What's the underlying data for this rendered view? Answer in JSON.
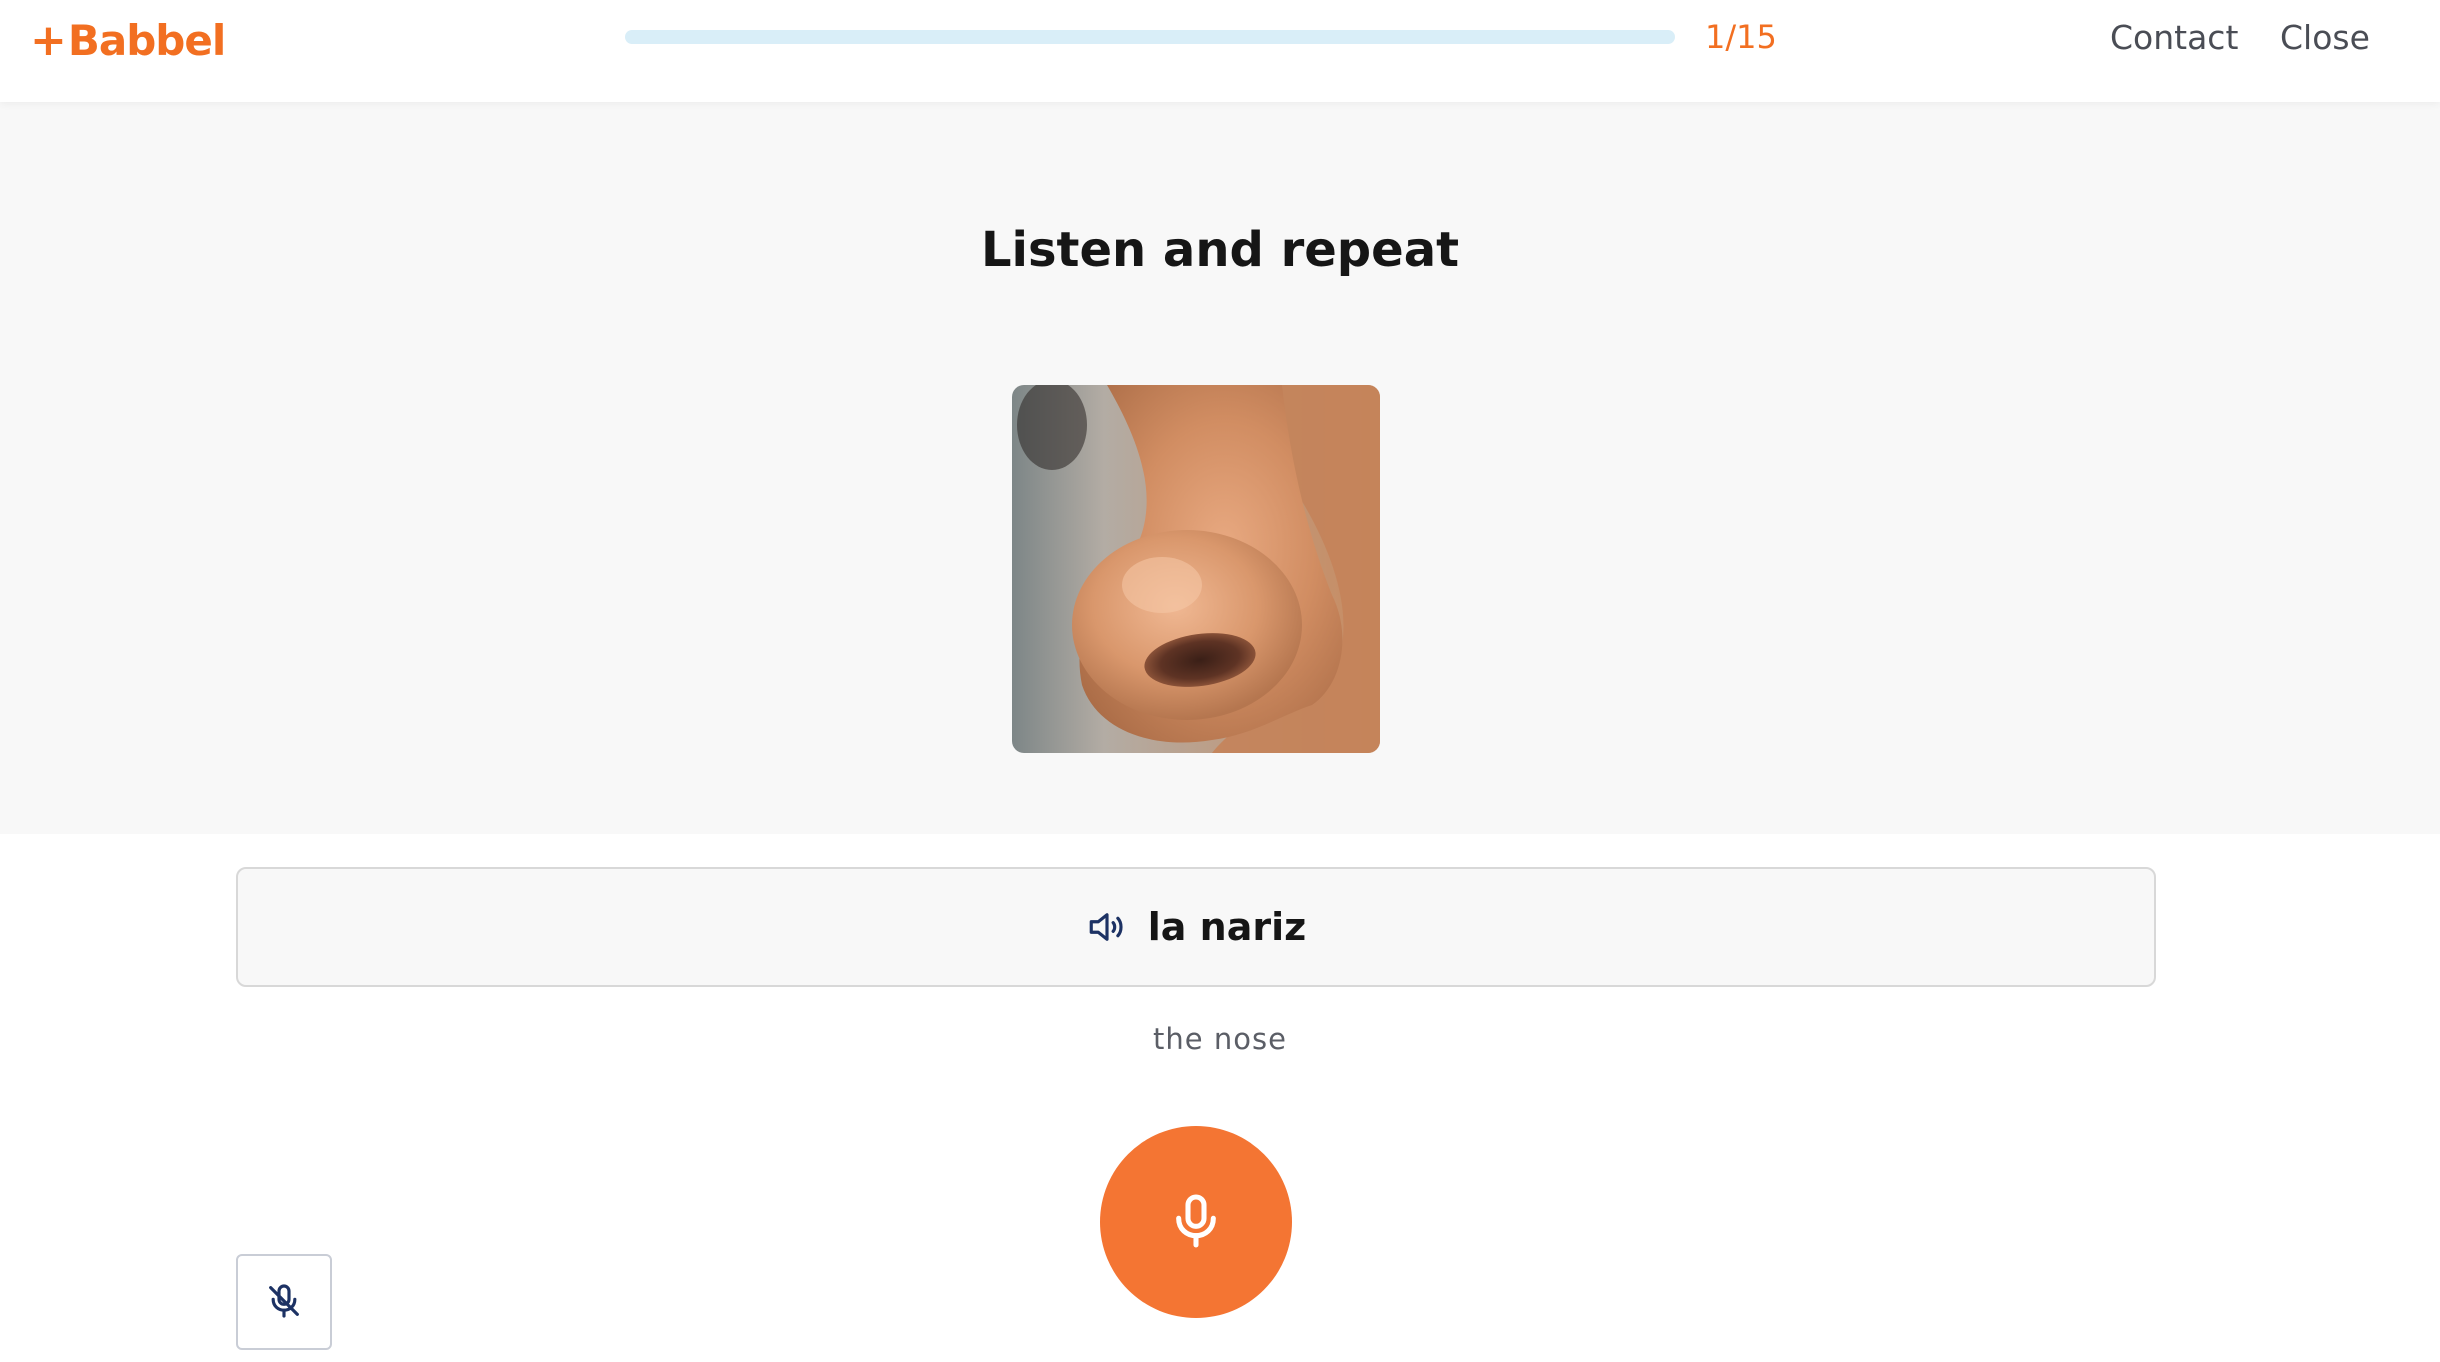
{
  "app": {
    "logo_text": "Babbel",
    "brand_color": "#f26f21",
    "accent_color": "#f47533"
  },
  "header": {
    "progress": {
      "current": 1,
      "total": 15,
      "label": "1/15"
    },
    "nav": {
      "contact_label": "Contact",
      "close_label": "Close"
    }
  },
  "prompt": {
    "title": "Listen and repeat",
    "image_icon": "nose-photo"
  },
  "answer": {
    "phrase": "la nariz",
    "translation": "the nose",
    "audio_icon": "speaker-icon"
  },
  "controls": {
    "record_icon": "microphone-icon",
    "mute_icon": "microphone-off-icon"
  }
}
